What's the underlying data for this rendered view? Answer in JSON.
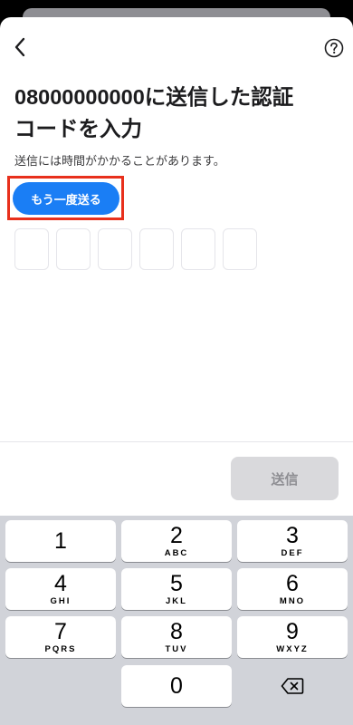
{
  "header": {
    "back_icon": "chevron-left-icon",
    "help_icon": "question-circle-icon"
  },
  "main": {
    "title": "08000000000に送信した認証\nコードを入力",
    "subtitle": "送信には時間がかかることがあります。",
    "resend_label": "もう一度送る",
    "code_length": 6,
    "code_values": [
      "",
      "",
      "",
      "",
      "",
      ""
    ]
  },
  "footer": {
    "send_label": "送信"
  },
  "keyboard": {
    "keys": [
      {
        "digit": "1",
        "letters": ""
      },
      {
        "digit": "2",
        "letters": "ABC"
      },
      {
        "digit": "3",
        "letters": "DEF"
      },
      {
        "digit": "4",
        "letters": "GHI"
      },
      {
        "digit": "5",
        "letters": "JKL"
      },
      {
        "digit": "6",
        "letters": "MNO"
      },
      {
        "digit": "7",
        "letters": "PQRS"
      },
      {
        "digit": "8",
        "letters": "TUV"
      },
      {
        "digit": "9",
        "letters": "WXYZ"
      },
      {
        "digit": "0",
        "letters": ""
      }
    ],
    "delete_icon": "backspace-icon"
  },
  "colors": {
    "accent": "#1a7ef5",
    "highlight": "#e8301c",
    "disabled_button": "#d9d9dc",
    "keyboard_bg": "#d1d3d9"
  }
}
